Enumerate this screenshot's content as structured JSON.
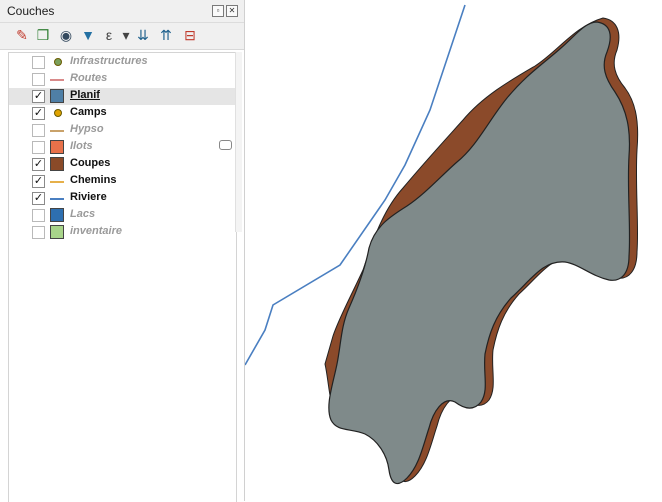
{
  "panel": {
    "title": "Couches",
    "header_buttons": [
      "float-button",
      "close-button"
    ],
    "float_glyph": "▫",
    "close_glyph": "✕"
  },
  "toolbar": {
    "tools": [
      {
        "name": "style-brush-icon",
        "glyph": "✎",
        "color": "#c0392b"
      },
      {
        "name": "add-group-icon",
        "glyph": "❒",
        "color": "#2e7d32"
      },
      {
        "name": "visibility-eye-icon",
        "glyph": "◉",
        "color": "#34495e"
      },
      {
        "name": "filter-icon",
        "glyph": "▼",
        "color": "#2471a3"
      },
      {
        "name": "expression-filter-icon",
        "glyph": "ε",
        "color": "#444444"
      },
      {
        "name": "dropdown-arrow-icon",
        "glyph": "▾",
        "color": "#444444"
      },
      {
        "name": "expand-all-icon",
        "glyph": "⇊",
        "color": "#1f618d"
      },
      {
        "name": "collapse-all-icon",
        "glyph": "⇈",
        "color": "#1f618d"
      },
      {
        "name": "remove-layer-icon",
        "glyph": "⊟",
        "color": "#c0392b"
      }
    ]
  },
  "layers": [
    {
      "label": "Infrastructures",
      "checked": false,
      "symbol": "point",
      "color": "#7ba05b",
      "selected": false
    },
    {
      "label": "Routes",
      "checked": false,
      "symbol": "line",
      "color": "#d98a8a",
      "selected": false
    },
    {
      "label": "Planif",
      "checked": true,
      "symbol": "fill",
      "color": "#4f7fa6",
      "selected": true
    },
    {
      "label": "Camps",
      "checked": true,
      "symbol": "point",
      "color": "#e0a300",
      "selected": false
    },
    {
      "label": "Hypso",
      "checked": false,
      "symbol": "line",
      "color": "#c9a26a",
      "selected": false
    },
    {
      "label": "Ilots",
      "checked": false,
      "symbol": "fill",
      "color": "#e8714a",
      "selected": false
    },
    {
      "label": "Coupes",
      "checked": true,
      "symbol": "fill",
      "color": "#8a4a28",
      "selected": false
    },
    {
      "label": "Chemins",
      "checked": true,
      "symbol": "line",
      "color": "#e6b04a",
      "selected": false
    },
    {
      "label": "Riviere",
      "checked": true,
      "symbol": "line",
      "color": "#4a7fc1",
      "selected": false
    },
    {
      "label": "Lacs",
      "checked": false,
      "symbol": "fill",
      "color": "#2e6fb0",
      "selected": false
    },
    {
      "label": "inventaire",
      "checked": false,
      "symbol": "fill",
      "color": "#a8d48a",
      "selected": false
    }
  ],
  "check_glyph": "✓",
  "map": {
    "colors": {
      "planif_fill": "#7f8a8a",
      "coupes_fill": "#8b4a2a",
      "river": "#4a7fc1",
      "outline": "#222222"
    }
  }
}
